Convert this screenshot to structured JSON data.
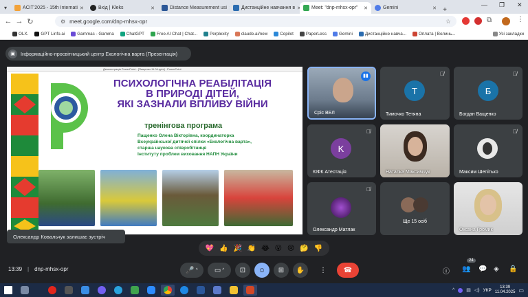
{
  "tabs": [
    {
      "title": "ACIT'2025 - 15th Internati",
      "color": "#f2a23a"
    },
    {
      "title": "Вхід | Kleks",
      "color": "#222"
    },
    {
      "title": "Distance Measurement usi",
      "color": "#2b5797"
    },
    {
      "title": "Дистанційне навчання в ",
      "color": "#2b6cb0"
    },
    {
      "title": "Meet: \"dnp-mhsx-opr\"",
      "color": "#34a853"
    },
    {
      "title": "Gemini",
      "color": "#4f7be8"
    }
  ],
  "address": {
    "url": "meet.google.com/dnp-mhsx-opr"
  },
  "bookmarks": [
    {
      "label": "OLX.",
      "color": "#333"
    },
    {
      "label": "GPT Linfo.ai",
      "color": "#111"
    },
    {
      "label": "Gammas - Gamma",
      "color": "#6a4bd6"
    },
    {
      "label": "ChatGPT",
      "color": "#10a37f"
    },
    {
      "label": "Free AI Chat | Chat...",
      "color": "#2da44e"
    },
    {
      "label": "Perplexity",
      "color": "#20808d"
    },
    {
      "label": "claude.ai/new",
      "color": "#d97757"
    },
    {
      "label": "Copilot",
      "color": "#2b88d8"
    },
    {
      "label": "PaperLess",
      "color": "#444"
    },
    {
      "label": "Gemini",
      "color": "#4f7be8"
    },
    {
      "label": "Дистанційне навча...",
      "color": "#2b6cb0"
    },
    {
      "label": "Оплата | Волинь...",
      "color": "#c43"
    }
  ],
  "bookmarks_all": "Усі закладки",
  "meet": {
    "presenter_title": "Інформаційно-просвітницький центр Екологічна варта (Презентація)",
    "ppt_window_title": "Демонстрація PowerPoint - [Пащенко-11.04.pptx] - PowerPoint",
    "slide": {
      "title_line1": "ПСИХОЛОГІЧНА РЕАБІЛІТАЦІЯ",
      "title_line2": "В ПРИРОДІ ДІТЕЙ,",
      "title_line3": "ЯКІ ЗАЗНАЛИ ВПЛИВУ ВІЙНИ",
      "subtitle": "тренінгова програма",
      "author_line1": "Пащенко Олена Вікторівна, координаторка",
      "author_line2": "Всеукраїнської дитячої спілки «Екологічна варта»,",
      "author_line3": "старша наукова співробітниця",
      "author_line4": "Інституту проблем виховання НАПН України"
    },
    "toast": "Олександр Ковальчук залишає зустріч",
    "participants": [
      {
        "name": "Сріс ВЕЛ",
        "initial": ""
      },
      {
        "name": "Тимочко Тетяна",
        "initial": "Т"
      },
      {
        "name": "Богдан Ващенко",
        "initial": "Б"
      },
      {
        "name": "КІФК Атестація",
        "initial": "K"
      },
      {
        "name": "Наталка Максимчук",
        "initial": ""
      },
      {
        "name": "Максим Шепітько",
        "initial": ""
      },
      {
        "name": "Олександр Матлак",
        "initial": ""
      },
      {
        "name": "Ще 15 осіб",
        "initial": ""
      },
      {
        "name": "Оксана Громик",
        "initial": ""
      }
    ],
    "reactions": [
      "💖",
      "👍",
      "🎉",
      "👏",
      "😂",
      "😮",
      "😢",
      "🤔",
      "👎"
    ],
    "time": "13:39",
    "meeting_code": "dnp-mhsx-opr",
    "participant_count": "24"
  },
  "taskbar": {
    "lang": "УКР",
    "time": "13:39",
    "date": "11.04.2025"
  }
}
